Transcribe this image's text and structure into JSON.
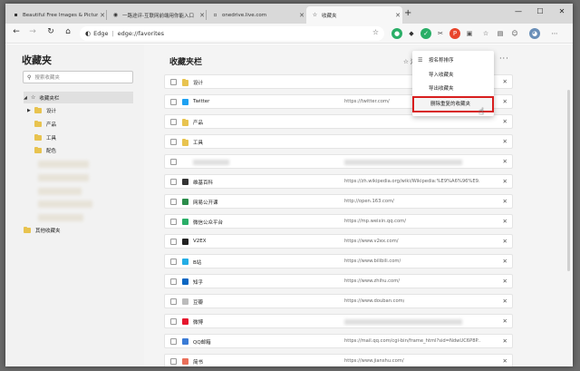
{
  "tabs": [
    {
      "label": "Beautiful Free Images & Pictures",
      "active": false
    },
    {
      "label": "一路途评-互联网前端用你能入口",
      "active": false
    },
    {
      "label": "onedrive.live.com",
      "active": false
    },
    {
      "label": "收藏夹",
      "active": true
    }
  ],
  "toolbar": {
    "edge_label": "Edge",
    "address": "edge://favorites"
  },
  "sidebar": {
    "title": "收藏夹",
    "search_placeholder": "搜索收藏夹",
    "root": "收藏夹栏",
    "folders": [
      "设计",
      "产品",
      "工具",
      "配色"
    ],
    "other": "其他收藏夹"
  },
  "main": {
    "title": "收藏夹栏",
    "add_label": "添",
    "rows": [
      {
        "type": "folder",
        "name": "设计",
        "url": ""
      },
      {
        "type": "site",
        "name": "Twitter",
        "url": "https://twitter.com/",
        "icon": "twitter-icon",
        "color": "#1da1f2"
      },
      {
        "type": "folder",
        "name": "产品",
        "url": ""
      },
      {
        "type": "folder",
        "name": "工具",
        "url": ""
      },
      {
        "type": "blurred",
        "name": "",
        "url": ""
      },
      {
        "type": "site",
        "name": "维基百科",
        "url": "https://zh.wikipedia.org/wiki/Wikipedia:%E9%A6%96%E9...",
        "icon": "wikipedia-icon",
        "color": "#333333"
      },
      {
        "type": "site",
        "name": "网易公开课",
        "url": "http://open.163.com/",
        "icon": "netease-icon",
        "color": "#2a8c4a"
      },
      {
        "type": "site",
        "name": "微信公众平台",
        "url": "https://mp.weixin.qq.com/",
        "icon": "wechat-icon",
        "color": "#2aae67"
      },
      {
        "type": "site",
        "name": "V2EX",
        "url": "https://www.v2ex.com/",
        "icon": "v2ex-icon",
        "color": "#222222"
      },
      {
        "type": "site",
        "name": "B站",
        "url": "https://www.bilibili.com/",
        "icon": "bilibili-icon",
        "color": "#23ade5"
      },
      {
        "type": "site",
        "name": "知乎",
        "url": "https://www.zhihu.com/",
        "icon": "zhihu-icon",
        "color": "#0a66c2"
      },
      {
        "type": "site",
        "name": "豆瓣",
        "url": "https://www.douban.com/",
        "icon": "douban-icon",
        "color": "#bbbbbb"
      },
      {
        "type": "site",
        "name": "微博",
        "url": "",
        "icon": "weibo-icon",
        "color": "#e6162d"
      },
      {
        "type": "site",
        "name": "QQ邮箱",
        "url": "https://mail.qq.com/cgi-bin/frame_html?sid=NdwUC6P8P...",
        "icon": "qqmail-icon",
        "color": "#3a7bd5"
      },
      {
        "type": "site",
        "name": "简书",
        "url": "https://www.jianshu.com/",
        "icon": "jianshu-icon",
        "color": "#ea6f5a"
      }
    ]
  },
  "menu": {
    "items": [
      {
        "label": "按名称排序",
        "icon": "sort-icon"
      },
      {
        "label": "导入收藏夹",
        "icon": ""
      },
      {
        "label": "导出收藏夹",
        "icon": ""
      },
      {
        "label": "删除重复的收藏夹",
        "icon": "",
        "highlighted": true
      }
    ]
  }
}
